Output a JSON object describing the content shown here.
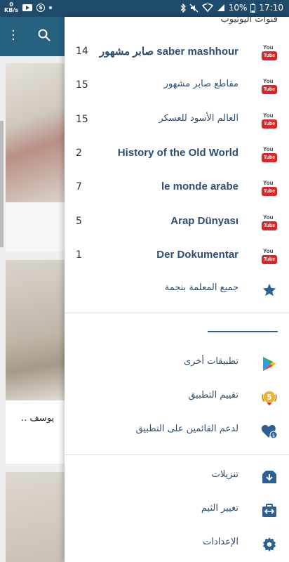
{
  "status_bar": {
    "net_speed_value": "0",
    "net_speed_unit": "KB/s",
    "battery": "10%",
    "time": "17:10"
  },
  "drawer": {
    "header": "قنوات اليوتيوب",
    "channels": [
      {
        "label": "صابر مشهور saber mashhour",
        "count": "14",
        "icon": "youtube-icon"
      },
      {
        "label": "مقاطع صابر مشهور",
        "count": "15",
        "icon": "youtube-icon"
      },
      {
        "label": "العالم الأسود للعسكر",
        "count": "15",
        "icon": "youtube-icon"
      },
      {
        "label": "History of the Old World",
        "count": "2",
        "icon": "youtube-icon"
      },
      {
        "label": "le monde arabe",
        "count": "7",
        "icon": "youtube-icon"
      },
      {
        "label": "Arap Dünyası",
        "count": "5",
        "icon": "youtube-icon"
      },
      {
        "label": "Der Dokumentar",
        "count": "1",
        "icon": "youtube-icon"
      }
    ],
    "starred": {
      "label": "جميع المعلمة بنجمة",
      "icon": "star-icon"
    },
    "apps": [
      {
        "label": "تطبيقات أخرى",
        "icon": "play-store-icon"
      },
      {
        "label": "تقييم التطبيق",
        "icon": "rating-badge-icon"
      },
      {
        "label": "لدعم القائمين على التطبيق",
        "icon": "donate-heart-icon"
      }
    ],
    "settings": [
      {
        "label": "تنزيلات",
        "icon": "download-icon"
      },
      {
        "label": "تغيير الثيم",
        "icon": "theme-icon"
      },
      {
        "label": "الإعدادات",
        "icon": "gear-icon"
      }
    ],
    "youtube_icon_text": {
      "top": "You",
      "box": "Tube"
    }
  },
  "background": {
    "caption": "يوسف .."
  },
  "colors": {
    "status_bar": "#1e4a6b",
    "app_bar": "#25617f",
    "link_text": "#2c4e74",
    "youtube_red": "#d9262b",
    "accent_blue": "#2c5f92"
  }
}
